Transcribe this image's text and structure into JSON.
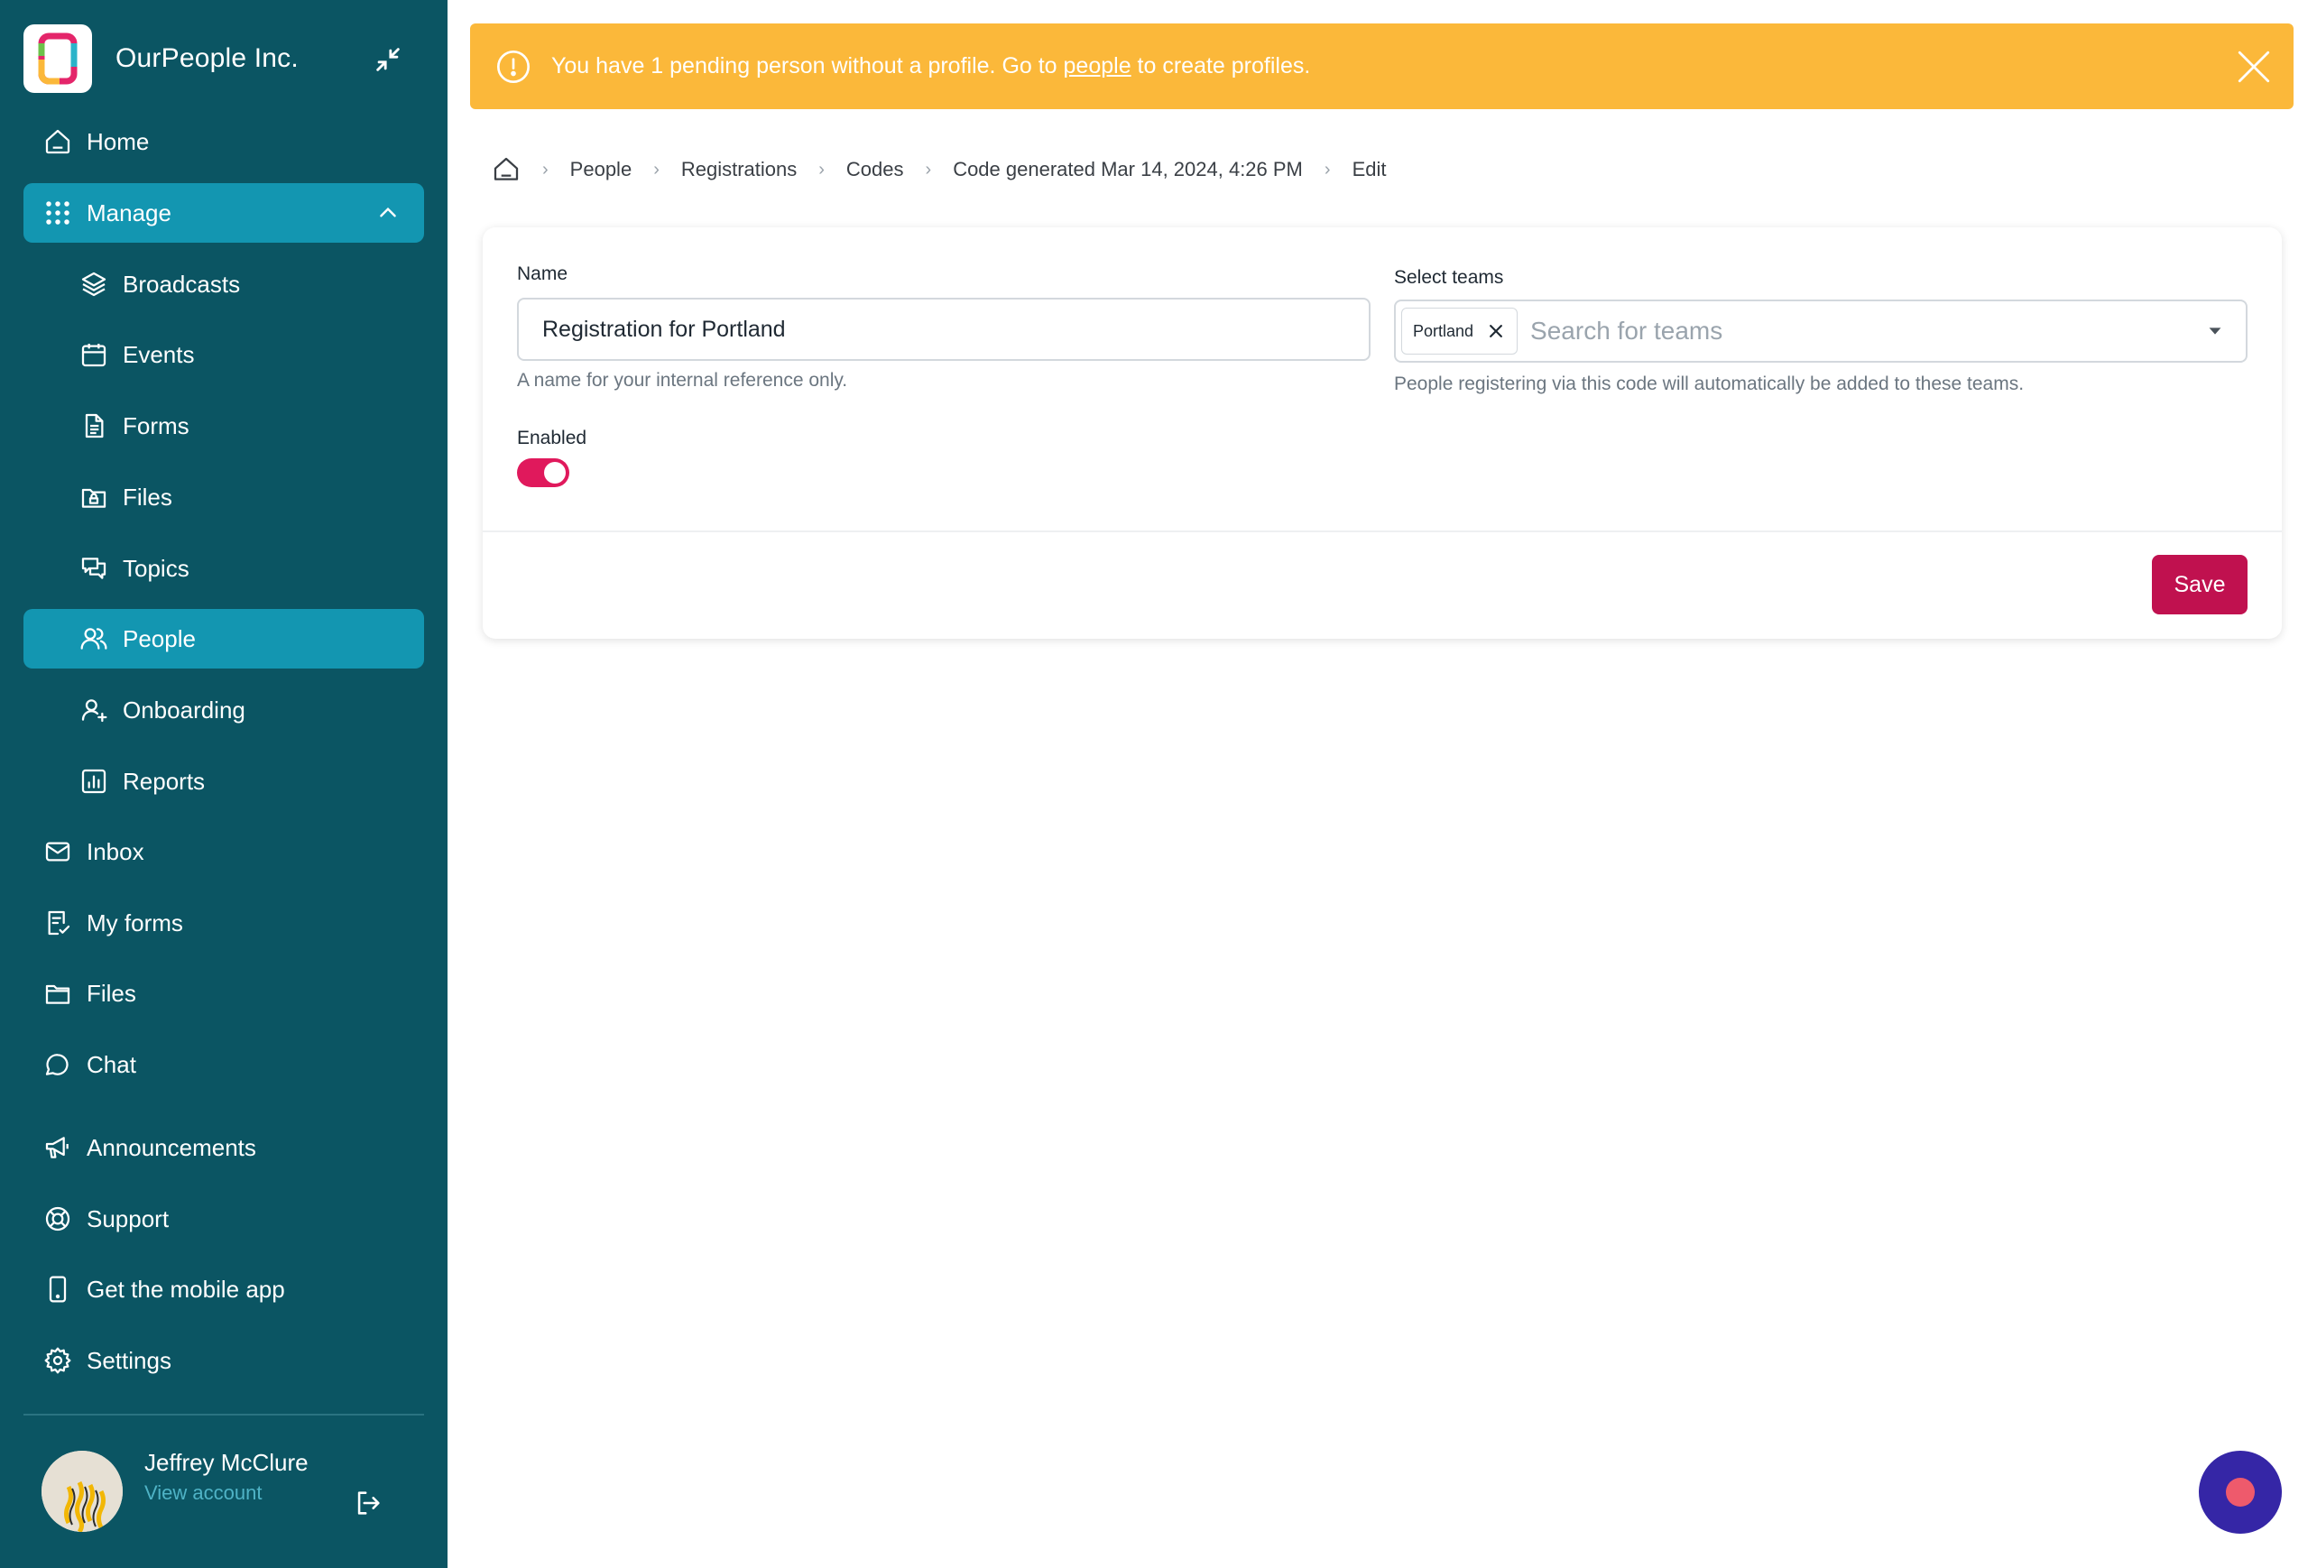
{
  "sidebar": {
    "org_name": "OurPeople Inc.",
    "items": [
      {
        "label": "Home",
        "icon": "home-icon"
      },
      {
        "label": "Manage",
        "icon": "grid-icon"
      },
      {
        "label": "Broadcasts",
        "icon": "layers-icon"
      },
      {
        "label": "Events",
        "icon": "calendar-icon"
      },
      {
        "label": "Forms",
        "icon": "document-icon"
      },
      {
        "label": "Files",
        "icon": "folder-lock-icon"
      },
      {
        "label": "Topics",
        "icon": "chat-bubbles-icon"
      },
      {
        "label": "People",
        "icon": "people-icon"
      },
      {
        "label": "Onboarding",
        "icon": "user-plus-icon"
      },
      {
        "label": "Reports",
        "icon": "bar-chart-icon"
      },
      {
        "label": "Inbox",
        "icon": "mail-icon"
      },
      {
        "label": "My forms",
        "icon": "checklist-icon"
      },
      {
        "label": "Files",
        "icon": "folder-icon"
      },
      {
        "label": "Chat",
        "icon": "chat-icon"
      },
      {
        "label": "Announcements",
        "icon": "megaphone-icon"
      },
      {
        "label": "Support",
        "icon": "lifebuoy-icon"
      },
      {
        "label": "Get the mobile app",
        "icon": "phone-icon"
      },
      {
        "label": "Settings",
        "icon": "gear-icon"
      }
    ],
    "user": {
      "name": "Jeffrey McClure",
      "link": "View account"
    }
  },
  "banner": {
    "text_before": "You have 1 pending person without a profile. Go to ",
    "link": "people",
    "text_after": " to create profiles."
  },
  "breadcrumb": {
    "items": [
      "People",
      "Registrations",
      "Codes",
      "Code generated Mar 14, 2024, 4:26 PM",
      "Edit"
    ]
  },
  "form": {
    "name_label": "Name",
    "name_value": "Registration for Portland",
    "name_help": "A name for your internal reference only.",
    "enabled_label": "Enabled",
    "enabled": true,
    "teams_label": "Select teams",
    "teams_selected": [
      "Portland"
    ],
    "teams_placeholder": "Search for teams",
    "teams_help": "People registering via this code will automatically be added to these teams.",
    "save_label": "Save"
  },
  "colors": {
    "sidebar_bg": "#0b5563",
    "sidebar_active": "#1396b1",
    "banner_bg": "#fbb83a",
    "save_bg": "#c0114f",
    "toggle_on": "#e0195c",
    "fab_bg": "#3526a6"
  }
}
